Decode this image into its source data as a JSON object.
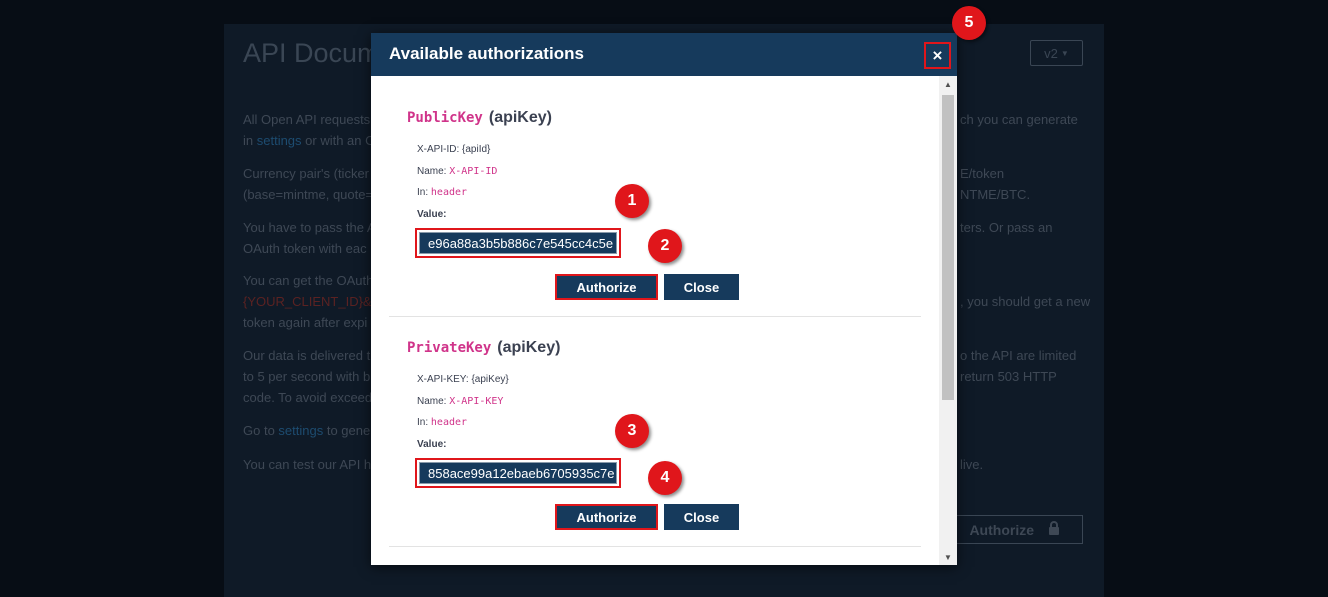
{
  "background": {
    "title": "API Docum",
    "version": "v2",
    "paragraphs": [
      {
        "a": "All Open API requests",
        "link": "settings",
        "b": " or with an C",
        "prefix": "in ",
        "right": "ch you can generate"
      },
      {
        "a": "Currency pair's (ticker",
        "b": "(base=mintme, quote=",
        "right1": "E/token",
        "right2": "NTME/BTC."
      },
      {
        "a": "You have to pass the A",
        "b": "OAuth token with eac",
        "right": "ters. Or pass an"
      },
      {
        "a": "You can get the OAuth",
        "red": "{YOUR_CLIENT_ID}&",
        "b": "token again after expi",
        "right": ", you should get a new"
      },
      {
        "a": "Our data is delivered t",
        "b": "to 5 per second with b",
        "c": "code. To avoid exceedi",
        "right1": "o the API are limited",
        "right2": "return 503 HTTP"
      },
      {
        "a": "Go to ",
        "link": "settings",
        "b": " to gene"
      },
      {
        "a": "You can test our API h",
        "right": "live."
      }
    ],
    "authorize_label": "Authorize",
    "lock_icon": "lock-icon"
  },
  "modal": {
    "title": "Available authorizations",
    "close_label": "×",
    "sections": [
      {
        "key_name": "PublicKey",
        "type": "(apiKey)",
        "header_line": "X-API-ID: {apiId}",
        "name_label": "Name: ",
        "name_value": "X-API-ID",
        "in_label": "In: ",
        "in_value": "header",
        "value_label": "Value:",
        "value": "e96a88a3b5b886c7e545cc4c5e",
        "authorize_label": "Authorize",
        "close_label": "Close"
      },
      {
        "key_name": "PrivateKey",
        "type": "(apiKey)",
        "header_line": "X-API-KEY: {apiKey}",
        "name_label": "Name: ",
        "name_value": "X-API-KEY",
        "in_label": "In: ",
        "in_value": "header",
        "value_label": "Value:",
        "value": "858ace99a12ebaeb6705935c7e",
        "authorize_label": "Authorize",
        "close_label": "Close"
      }
    ]
  },
  "annotations": [
    "1",
    "2",
    "3",
    "4",
    "5"
  ],
  "colors": {
    "header": "#163a5c",
    "highlight": "#e0161b",
    "key_name": "#d0348a"
  }
}
